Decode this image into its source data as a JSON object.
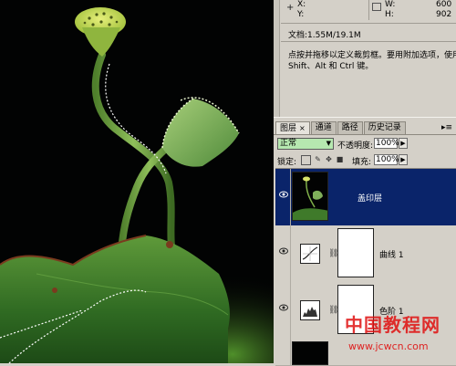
{
  "info": {
    "x_label": "X:",
    "y_label": "Y:",
    "w_label": "W:",
    "w_value": "600",
    "h_label": "H:",
    "h_value": "902",
    "doc_size": "文档:1.55M/19.1M",
    "hint_line1": "点按并拖移以定义裁剪框。要用附加选项，使用",
    "hint_line2": "Shift、Alt 和 Ctrl 键。"
  },
  "layers_panel": {
    "tabs": [
      {
        "label": "图层",
        "close": "×"
      },
      {
        "label": "通道"
      },
      {
        "label": "路径"
      },
      {
        "label": "历史记录"
      }
    ],
    "menu_icon": "▸≡",
    "blend_mode": "正常",
    "opacity_label": "不透明度:",
    "opacity_value": "100%",
    "lock_label": "锁定:",
    "fill_label": "填充:",
    "fill_value": "100%",
    "layers": [
      {
        "name": "盖印层",
        "selected": true
      },
      {
        "name": "曲线 1",
        "selected": false
      },
      {
        "name": "色阶 1",
        "selected": false
      }
    ]
  },
  "watermark": {
    "line1": "中国教程网",
    "line2": "www.jcwcn.com"
  },
  "colors": {
    "selection_blue": "#0a246a",
    "blend_green": "#b6e8b0",
    "panel_gray": "#d4d0c8"
  }
}
